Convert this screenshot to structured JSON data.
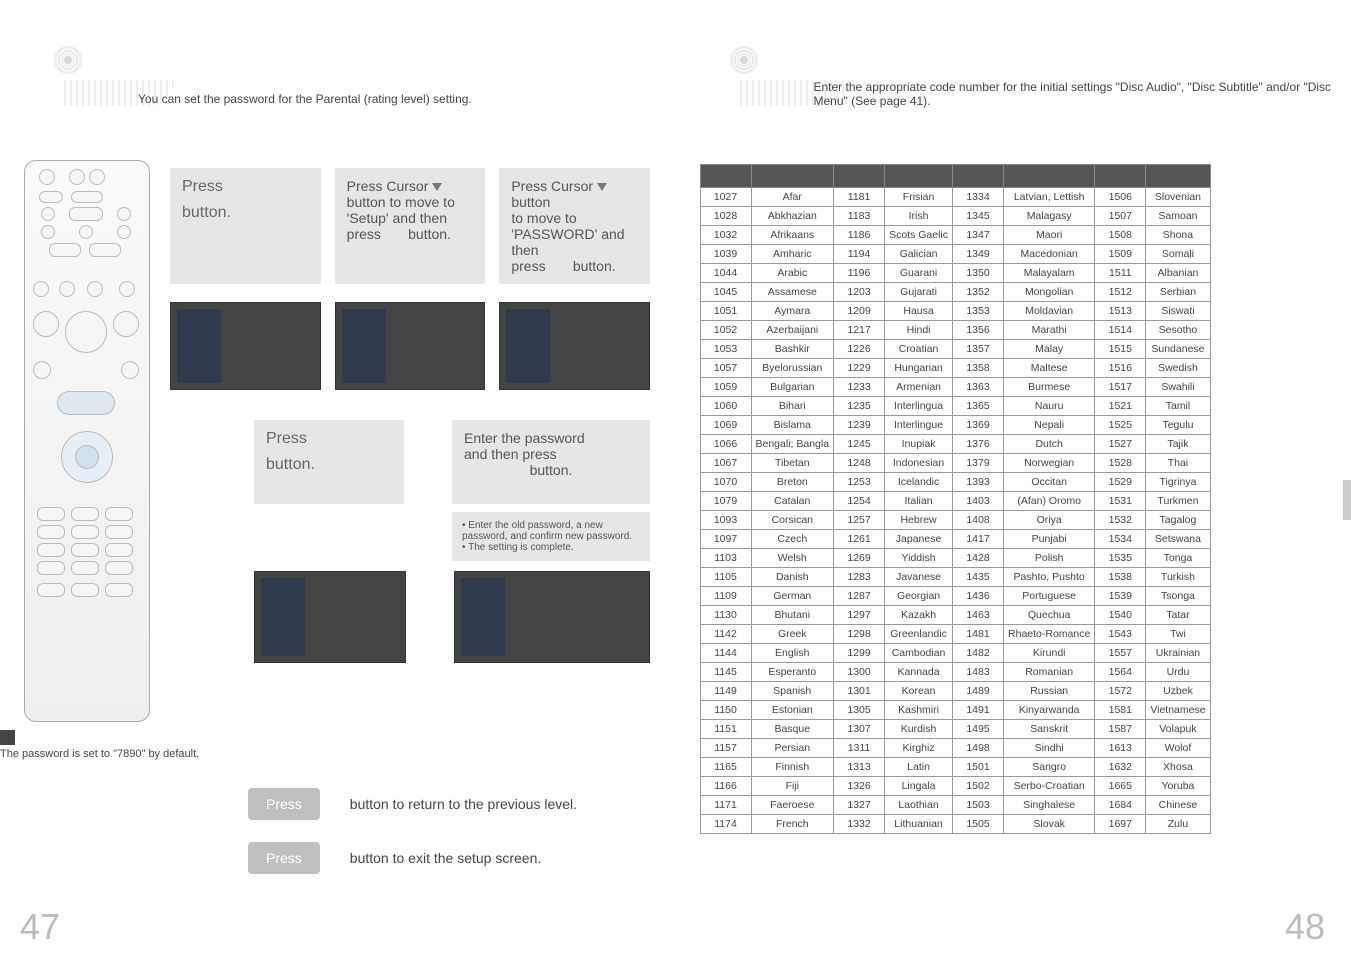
{
  "left": {
    "intro": "You can set the password for the Parental (rating level) setting.",
    "step1": {
      "press": "Press",
      "button": "button."
    },
    "step2": {
      "l1": "Press Cursor",
      "l2": "button to move to",
      "l3": "'Setup' and then",
      "press": "press",
      "button": "button."
    },
    "step3": {
      "l1": "Press Cursor",
      "l1b": "button",
      "l2": "to move to",
      "l3": "'PASSWORD' and then",
      "press": "press",
      "button": "button."
    },
    "step4": {
      "press": "Press",
      "button": "button."
    },
    "step5": {
      "l1": "Enter the password",
      "l2": "and then press",
      "button": "button."
    },
    "note_a": "Enter the old password, a new password, and confirm new password.",
    "note_b": "The setting is complete.",
    "default_note": "The password is set to \"7890\" by default.",
    "return_press": "Press",
    "return_text": "button to return to the previous level.",
    "exit_press": "Press",
    "exit_text": "button to exit the setup screen.",
    "pagenum": "47"
  },
  "right": {
    "intro": "Enter the appropriate code number for the initial settings \"Disc Audio\", \"Disc Subtitle\" and/or \"Disc Menu\" (See page 41).",
    "pagenum": "48",
    "rows": [
      [
        "1027",
        "Afar",
        "1181",
        "Frisian",
        "1334",
        "Latvian, Lettish",
        "1506",
        "Slovenian"
      ],
      [
        "1028",
        "Abkhazian",
        "1183",
        "Irish",
        "1345",
        "Malagasy",
        "1507",
        "Samoan"
      ],
      [
        "1032",
        "Afrikaans",
        "1186",
        "Scots Gaelic",
        "1347",
        "Maori",
        "1508",
        "Shona"
      ],
      [
        "1039",
        "Amharic",
        "1194",
        "Galician",
        "1349",
        "Macedonian",
        "1509",
        "Somali"
      ],
      [
        "1044",
        "Arabic",
        "1196",
        "Guarani",
        "1350",
        "Malayalam",
        "1511",
        "Albanian"
      ],
      [
        "1045",
        "Assamese",
        "1203",
        "Gujarati",
        "1352",
        "Mongolian",
        "1512",
        "Serbian"
      ],
      [
        "1051",
        "Aymara",
        "1209",
        "Hausa",
        "1353",
        "Moldavian",
        "1513",
        "Siswati"
      ],
      [
        "1052",
        "Azerbaijani",
        "1217",
        "Hindi",
        "1356",
        "Marathi",
        "1514",
        "Sesotho"
      ],
      [
        "1053",
        "Bashkir",
        "1226",
        "Croatian",
        "1357",
        "Malay",
        "1515",
        "Sundanese"
      ],
      [
        "1057",
        "Byelorussian",
        "1229",
        "Hungarian",
        "1358",
        "Maltese",
        "1516",
        "Swedish"
      ],
      [
        "1059",
        "Bulgarian",
        "1233",
        "Armenian",
        "1363",
        "Burmese",
        "1517",
        "Swahili"
      ],
      [
        "1060",
        "Bihari",
        "1235",
        "Interlingua",
        "1365",
        "Nauru",
        "1521",
        "Tamil"
      ],
      [
        "1069",
        "Bislama",
        "1239",
        "Interlingue",
        "1369",
        "Nepali",
        "1525",
        "Tegulu"
      ],
      [
        "1066",
        "Bengali; Bangla",
        "1245",
        "Inupiak",
        "1376",
        "Dutch",
        "1527",
        "Tajik"
      ],
      [
        "1067",
        "Tibetan",
        "1248",
        "Indonesian",
        "1379",
        "Norwegian",
        "1528",
        "Thai"
      ],
      [
        "1070",
        "Breton",
        "1253",
        "Icelandic",
        "1393",
        "Occitan",
        "1529",
        "Tigrinya"
      ],
      [
        "1079",
        "Catalan",
        "1254",
        "Italian",
        "1403",
        "(Afan) Oromo",
        "1531",
        "Turkmen"
      ],
      [
        "1093",
        "Corsican",
        "1257",
        "Hebrew",
        "1408",
        "Oriya",
        "1532",
        "Tagalog"
      ],
      [
        "1097",
        "Czech",
        "1261",
        "Japanese",
        "1417",
        "Punjabi",
        "1534",
        "Setswana"
      ],
      [
        "1103",
        "Welsh",
        "1269",
        "Yiddish",
        "1428",
        "Polish",
        "1535",
        "Tonga"
      ],
      [
        "1105",
        "Danish",
        "1283",
        "Javanese",
        "1435",
        "Pashto, Pushto",
        "1538",
        "Turkish"
      ],
      [
        "1109",
        "German",
        "1287",
        "Georgian",
        "1436",
        "Portuguese",
        "1539",
        "Tsonga"
      ],
      [
        "1130",
        "Bhutani",
        "1297",
        "Kazakh",
        "1463",
        "Quechua",
        "1540",
        "Tatar"
      ],
      [
        "1142",
        "Greek",
        "1298",
        "Greenlandic",
        "1481",
        "Rhaeto-Romance",
        "1543",
        "Twi"
      ],
      [
        "1144",
        "English",
        "1299",
        "Cambodian",
        "1482",
        "Kirundi",
        "1557",
        "Ukrainian"
      ],
      [
        "1145",
        "Esperanto",
        "1300",
        "Kannada",
        "1483",
        "Romanian",
        "1564",
        "Urdu"
      ],
      [
        "1149",
        "Spanish",
        "1301",
        "Korean",
        "1489",
        "Russian",
        "1572",
        "Uzbek"
      ],
      [
        "1150",
        "Estonian",
        "1305",
        "Kashmiri",
        "1491",
        "Kinyarwanda",
        "1581",
        "Vietnamese"
      ],
      [
        "1151",
        "Basque",
        "1307",
        "Kurdish",
        "1495",
        "Sanskrit",
        "1587",
        "Volapuk"
      ],
      [
        "1157",
        "Persian",
        "1311",
        "Kirghiz",
        "1498",
        "Sindhi",
        "1613",
        "Wolof"
      ],
      [
        "1165",
        "Finnish",
        "1313",
        "Latin",
        "1501",
        "Sangro",
        "1632",
        "Xhosa"
      ],
      [
        "1166",
        "Fiji",
        "1326",
        "Lingala",
        "1502",
        "Serbo-Croatian",
        "1665",
        "Yoruba"
      ],
      [
        "1171",
        "Faeroese",
        "1327",
        "Laothian",
        "1503",
        "Singhalese",
        "1684",
        "Chinese"
      ],
      [
        "1174",
        "French",
        "1332",
        "Lithuanian",
        "1505",
        "Slovak",
        "1697",
        "Zulu"
      ]
    ]
  }
}
